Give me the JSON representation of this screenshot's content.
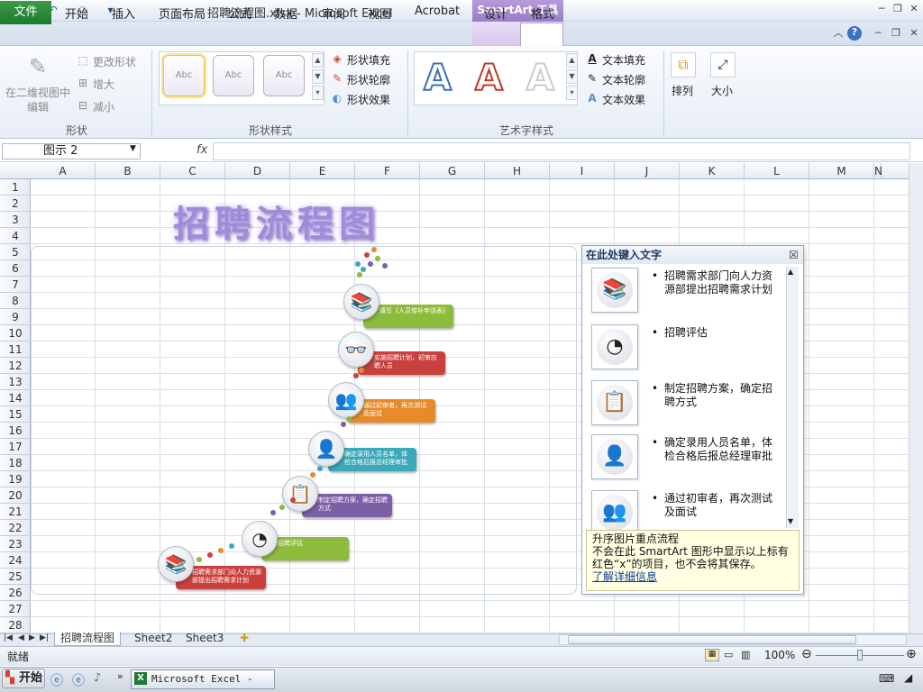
{
  "window": {
    "title": "招聘流程图.xlsx - Microsoft Excel",
    "smartart_tools": "SmartArt 工具"
  },
  "ribbon_tabs": {
    "file": "文件",
    "tabs": [
      "开始",
      "插入",
      "页面布局",
      "公式",
      "数据",
      "审阅",
      "视图",
      "Acrobat",
      "设计",
      "格式"
    ]
  },
  "ribbon": {
    "shapes": {
      "edit_2d": "在二维视图中",
      "edit_2d_2": "编辑",
      "change_shape": "更改形状",
      "larger": "增大",
      "smaller": "减小",
      "label": "形状"
    },
    "shape_styles": {
      "thumb": "Abc",
      "fill": "形状填充",
      "outline": "形状轮廓",
      "effects": "形状效果",
      "label": "形状样式"
    },
    "wordart": {
      "letter": "A",
      "fill": "文本填充",
      "outline": "文本轮廓",
      "effects": "文本效果",
      "label": "艺术字样式"
    },
    "arrange": "排列",
    "size": "大小"
  },
  "formula": {
    "name_box": "图示 2",
    "fx": "fx",
    "value": ""
  },
  "columns": [
    "A",
    "B",
    "C",
    "D",
    "E",
    "F",
    "G",
    "H",
    "I",
    "J",
    "K",
    "L",
    "M",
    "N"
  ],
  "rows": [
    "1",
    "2",
    "3",
    "4",
    "5",
    "6",
    "7",
    "8",
    "9",
    "10",
    "11",
    "12",
    "13",
    "14",
    "15",
    "16",
    "17",
    "18",
    "19",
    "20",
    "21",
    "22",
    "23",
    "24",
    "25",
    "26",
    "27",
    "28"
  ],
  "sheet_title": "招聘流程图",
  "smartart": {
    "steps": [
      "招聘需求部门向人力资源部提出招聘需求计划",
      "招聘评估",
      "制定招聘方案，确定招聘方式",
      "确定录用人员名单，体检合格后报总经理审批",
      "通过初审者，再次测试及面试",
      "实施招聘计划，初审应聘人员",
      "填写《人员增补申请表》"
    ],
    "colors": {
      "green": "#8dbb3c",
      "red": "#c9403d",
      "orange": "#e78b2a",
      "teal": "#3aa9b9",
      "purple": "#7d5fa5"
    }
  },
  "text_pane": {
    "header": "在此处键入文字",
    "items": [
      "招聘需求部门向人力资源部提出招聘需求计划",
      "招聘评估",
      "制定招聘方案，确定招聘方式",
      "确定录用人员名单，体检合格后报总经理审批",
      "通过初审者，再次测试及面试"
    ],
    "info_title": "升序图片重点流程",
    "info_body": "不会在此 SmartArt 图形中显示以上标有红色“x”的项目，也不会将其保存。",
    "info_link": "了解详细信息"
  },
  "sheets": [
    "招聘流程图",
    "Sheet2",
    "Sheet3"
  ],
  "status": {
    "ready": "就绪",
    "zoom": "100%"
  },
  "taskbar": {
    "start": "开始",
    "excel_task": "Microsoft Excel - ..."
  }
}
